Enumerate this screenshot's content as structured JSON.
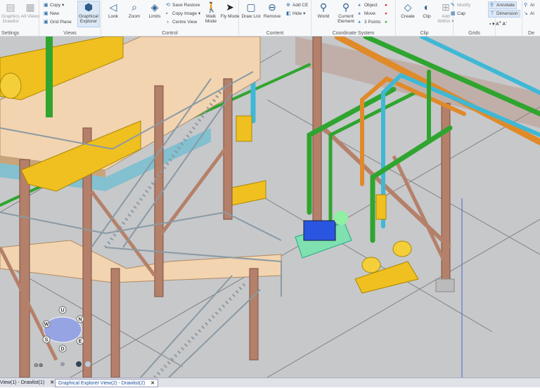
{
  "ribbon": {
    "settings": {
      "label": "Settings",
      "graphics_drawlist": "Graphics Drawlist",
      "all_views": "All Views"
    },
    "views": {
      "label": "Views",
      "copy": "Copy ▾",
      "new": "New",
      "grid_plane": "Grid Plane",
      "graphical_explorer": "Graphical Explorer"
    },
    "control": {
      "label": "Control",
      "look": "Look",
      "zoom": "Zoom",
      "limits": "Limits",
      "save_restore": "Save Restore",
      "copy_image": "Copy Image ▾",
      "centre_view": "Centre View",
      "walk_mode": "Walk Mode",
      "fly_mode": "Fly Mode"
    },
    "content": {
      "label": "Content",
      "draw_list": "Draw List",
      "remove": "Remove",
      "add_ce": "Add CE",
      "hide": "Hide ▾"
    },
    "coordinate_system": {
      "label": "Coordinate System",
      "world": "World",
      "current_element": "Current Element",
      "object": "Object",
      "move": "Move",
      "three_points": "3 Points"
    },
    "clip": {
      "label": "Clip",
      "create": "Create",
      "clip": "Clip",
      "add_within": "Add Within ▾",
      "modify": "Modify",
      "cap": "Cap"
    },
    "grids": {
      "label": "Grids",
      "annotate": "Annotate",
      "dimension": "Dimension"
    },
    "de": {
      "label": "De",
      "a1": "Ar",
      "a2": "Ai"
    }
  },
  "navigator": {
    "up": "U",
    "down": "D",
    "north": "N",
    "south": "S",
    "east": "E",
    "west": "W"
  },
  "tabs": [
    {
      "label": "View(1) - Drawlist(1)",
      "active": false
    },
    {
      "label": "Graphical Explorer View(2) - Drawlist(2)",
      "active": true
    }
  ],
  "colors": {
    "steel": "#b5806a",
    "platform": "#f2d4b0",
    "pipe_green": "#2fa52f",
    "pipe_blue": "#3fb8d6",
    "pipe_orange": "#e08a2a",
    "equipment_yellow": "#f0c020",
    "floor": "#c7c8ca",
    "selected_blue": "#2a55e0"
  }
}
